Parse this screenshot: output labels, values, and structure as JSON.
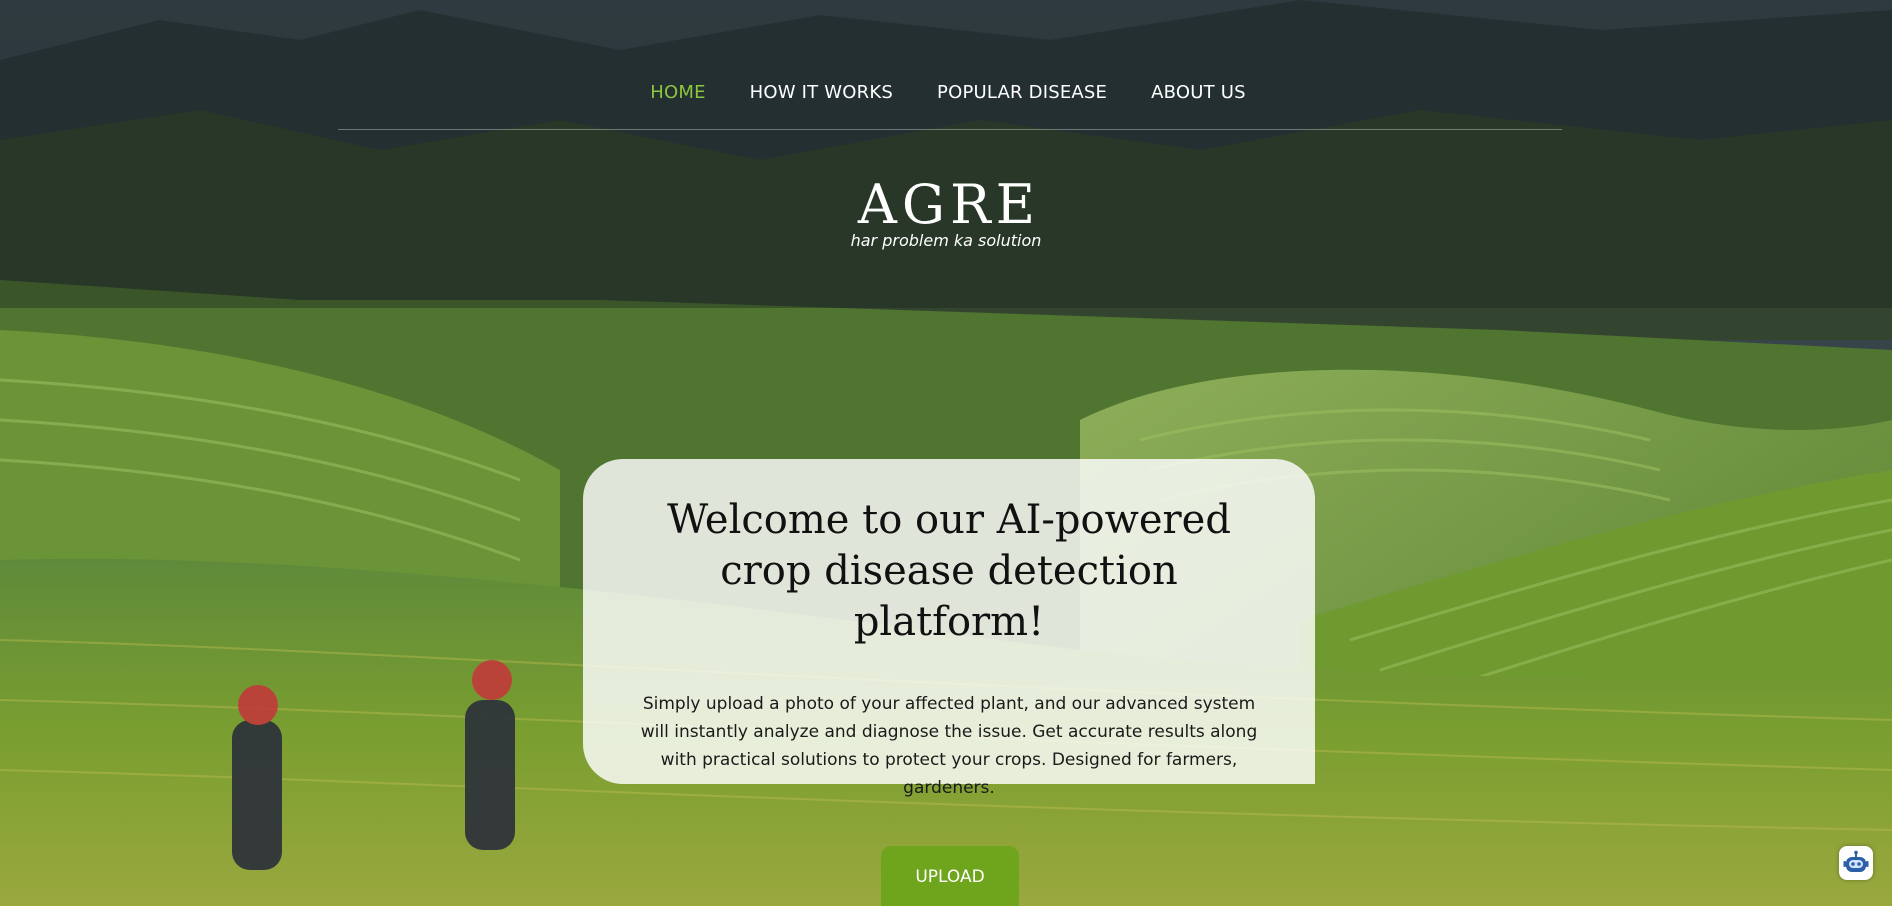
{
  "nav": {
    "items": [
      {
        "label": "HOME",
        "active": true
      },
      {
        "label": "HOW IT WORKS",
        "active": false
      },
      {
        "label": "POPULAR DISEASE",
        "active": false
      },
      {
        "label": "ABOUT US",
        "active": false
      }
    ]
  },
  "brand": {
    "title": "AGRE",
    "tagline": "har problem ka solution"
  },
  "welcome": {
    "heading": "Welcome to our AI-powered crop disease detection platform!",
    "body": "Simply upload a photo of your affected plant, and our advanced system will instantly analyze and diagnose the issue. Get accurate results along with practical solutions to protect your crops. Designed for farmers, gardeners."
  },
  "upload": {
    "label": "UPLOAD"
  },
  "chatbot": {
    "icon": "robot-icon"
  },
  "colors": {
    "accent": "#8cc63f",
    "button": "#6fa51c"
  }
}
